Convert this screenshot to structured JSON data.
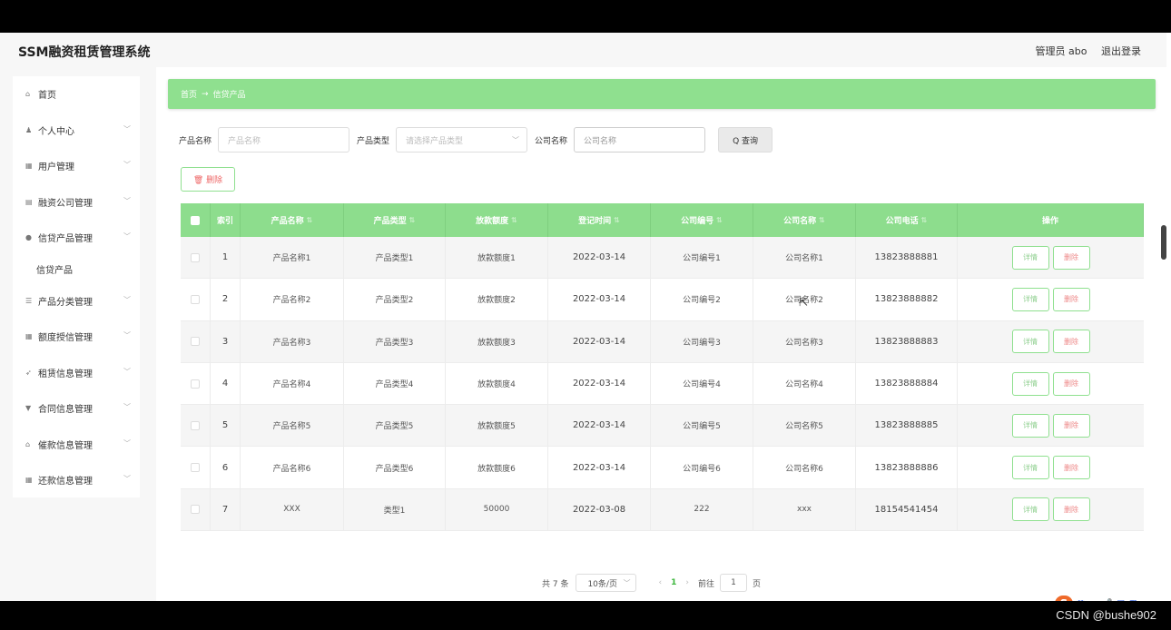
{
  "header": {
    "brand": "SSM融资租赁管理系统",
    "user": "管理员 abo",
    "logout": "退出登录"
  },
  "sidebar": {
    "items": [
      {
        "label": "首页",
        "icon": "home-icon",
        "glyph": "⌂"
      },
      {
        "label": "个人中心",
        "icon": "person-icon",
        "glyph": "♟"
      },
      {
        "label": "用户管理",
        "icon": "grid-icon",
        "glyph": "▦"
      },
      {
        "label": "融资公司管理",
        "icon": "building-icon",
        "glyph": "▤"
      },
      {
        "label": "信贷产品管理",
        "icon": "location-icon",
        "glyph": "●"
      },
      {
        "label": "产品分类管理",
        "icon": "list-icon",
        "glyph": "☰"
      },
      {
        "label": "额度授信管理",
        "icon": "grid-icon",
        "glyph": "▦"
      },
      {
        "label": "租赁信息管理",
        "icon": "send-icon",
        "glyph": "➶"
      },
      {
        "label": "合同信息管理",
        "icon": "filter-icon",
        "glyph": "▼"
      },
      {
        "label": "催款信息管理",
        "icon": "bank-icon",
        "glyph": "⌂"
      },
      {
        "label": "还款信息管理",
        "icon": "grid-icon",
        "glyph": "▦"
      }
    ],
    "sub_item": "信贷产品"
  },
  "breadcrumb": {
    "home": "首页",
    "arrow": "→",
    "current": "信贷产品"
  },
  "filters": {
    "product_name_label": "产品名称",
    "product_name_placeholder": "产品名称",
    "product_type_label": "产品类型",
    "product_type_placeholder": "请选择产品类型",
    "company_name_label": "公司名称",
    "company_name_placeholder": "公司名称",
    "search_label": "Q 查询"
  },
  "delete_button": "🗑 删除",
  "table": {
    "headers": [
      "",
      "索引",
      "产品名称",
      "产品类型",
      "放款额度",
      "登记时间",
      "公司编号",
      "公司名称",
      "公司电话",
      "操作"
    ],
    "rows": [
      [
        "1",
        "产品名称1",
        "产品类型1",
        "放款额度1",
        "2022-03-14",
        "公司编号1",
        "公司名称1",
        "13823888881"
      ],
      [
        "2",
        "产品名称2",
        "产品类型2",
        "放款额度2",
        "2022-03-14",
        "公司编号2",
        "公司名称2",
        "13823888882"
      ],
      [
        "3",
        "产品名称3",
        "产品类型3",
        "放款额度3",
        "2022-03-14",
        "公司编号3",
        "公司名称3",
        "13823888883"
      ],
      [
        "4",
        "产品名称4",
        "产品类型4",
        "放款额度4",
        "2022-03-14",
        "公司编号4",
        "公司名称4",
        "13823888884"
      ],
      [
        "5",
        "产品名称5",
        "产品类型5",
        "放款额度5",
        "2022-03-14",
        "公司编号5",
        "公司名称5",
        "13823888885"
      ],
      [
        "6",
        "产品名称6",
        "产品类型6",
        "放款额度6",
        "2022-03-14",
        "公司编号6",
        "公司名称6",
        "13823888886"
      ],
      [
        "7",
        "XXX",
        "类型1",
        "50000",
        "2022-03-08",
        "222",
        "xxx",
        "18154541454"
      ]
    ],
    "detail_label": "详情",
    "remove_label": "删除"
  },
  "pager": {
    "total": "共 7 条",
    "page_size": "10条/页",
    "current": "1",
    "goto": "前往",
    "goto_value": "1",
    "page_unit": "页"
  },
  "ime": {
    "s": "S",
    "lang": "英",
    "items": [
      "•,",
      "🎤",
      "▤",
      "▦"
    ]
  },
  "watermark": "CSDN @bushe902",
  "colors": {
    "accent": "#8fe08f",
    "header_green": "#8ddd8d",
    "danger": "#e66666"
  }
}
